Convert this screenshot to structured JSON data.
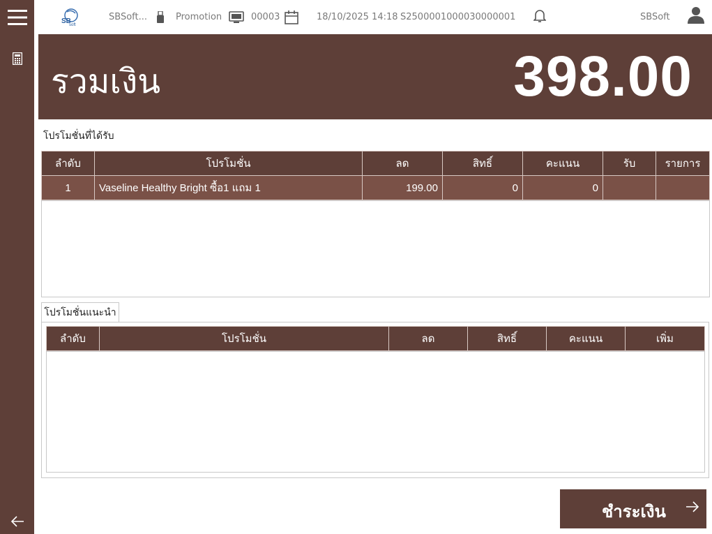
{
  "header": {
    "company_short": "SBSoft...",
    "module": "Promotion",
    "terminal": "00003",
    "datetime": "18/10/2025 14:18",
    "doc_no": "S2500001000030000001",
    "user": "SBSoft",
    "logo_text": "SB Soft"
  },
  "total": {
    "label": "รวมเงิน",
    "amount": "398.00"
  },
  "received": {
    "title": "โปรโมชั่นที่ได้รับ",
    "columns": [
      "ลำดับ",
      "โปรโมชั่น",
      "ลด",
      "สิทธิ์",
      "คะแนน",
      "รับ",
      "รายการ"
    ],
    "rows": [
      {
        "no": "1",
        "promotion": "Vaseline Healthy Bright ซื้อ1 แถม 1",
        "discount": "199.00",
        "rights": "0",
        "points": "0",
        "receive": "",
        "items": ""
      }
    ]
  },
  "suggested": {
    "tab_label": "โปรโมชั่นแนะนำ",
    "columns": [
      "ลำดับ",
      "โปรโมชั่น",
      "ลด",
      "สิทธิ์",
      "คะแนน",
      "เพิ่ม"
    ]
  },
  "pay_button": {
    "label": "ชำระเงิน"
  },
  "colors": {
    "brand": "#5e3f38",
    "row_selected": "#7a5147"
  }
}
